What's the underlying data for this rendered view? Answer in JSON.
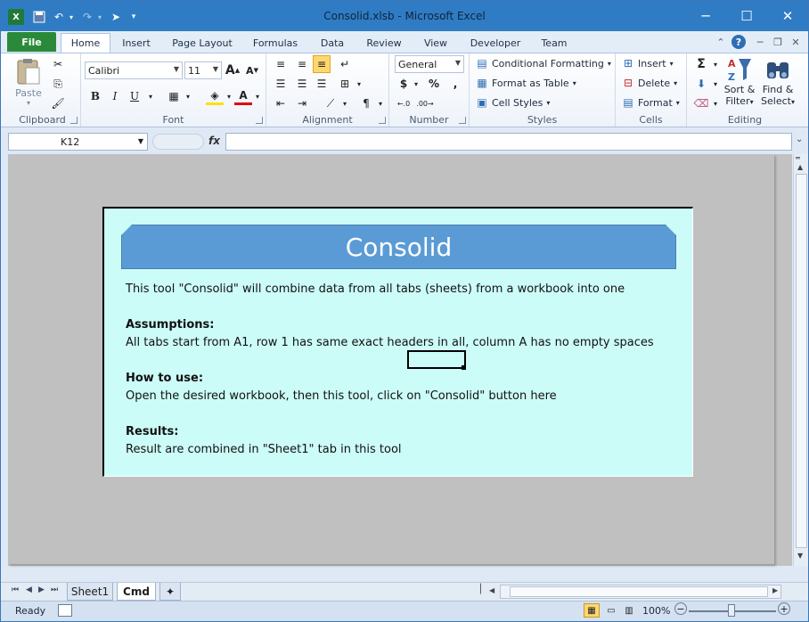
{
  "window": {
    "title": "Consolid.xlsb  -  Microsoft Excel"
  },
  "qat": {
    "excel_icon": "excel-icon",
    "save_icon": "save-icon",
    "undo_icon": "undo-icon",
    "redo_icon": "redo-icon"
  },
  "tabs": {
    "file": "File",
    "items": [
      "Home",
      "Insert",
      "Page Layout",
      "Formulas",
      "Data",
      "Review",
      "View",
      "Developer",
      "Team"
    ]
  },
  "ribbon": {
    "clipboard": {
      "label": "Clipboard",
      "paste": "Paste"
    },
    "font": {
      "label": "Font",
      "name": "Calibri",
      "size": "11"
    },
    "alignment": {
      "label": "Alignment"
    },
    "number": {
      "label": "Number",
      "format": "General",
      "currency": "$",
      "percent": "%",
      "comma": ","
    },
    "styles": {
      "label": "Styles",
      "conditional": "Conditional Formatting",
      "format_table": "Format as Table",
      "cell_styles": "Cell Styles"
    },
    "cells": {
      "label": "Cells",
      "insert": "Insert",
      "delete": "Delete",
      "format": "Format"
    },
    "editing": {
      "label": "Editing",
      "sort_1": "Sort &",
      "sort_2": "Filter",
      "find_1": "Find &",
      "find_2": "Select"
    }
  },
  "formula_bar": {
    "name_box": "K12",
    "fx": "fx",
    "formula": ""
  },
  "document": {
    "banner": "Consolid",
    "intro": "This tool \"Consolid\" will combine data from all tabs (sheets) from a workbook into one",
    "assumptions_heading": "Assumptions:",
    "assumptions_text": "All tabs start from A1, row 1 has same exact headers in all, column A has no empty spaces",
    "howto_heading": "How to use:",
    "howto_text": "Open the desired workbook, then this tool, click on \"Consolid\" button here",
    "results_heading": "Results:",
    "results_text": "Result are combined in \"Sheet1\" tab in this tool"
  },
  "sheets": {
    "items": [
      "Sheet1",
      "Cmd"
    ],
    "active": "Cmd"
  },
  "status": {
    "ready": "Ready",
    "zoom": "100%"
  },
  "colors": {
    "title_bar": "#2f7cc4",
    "file_tab": "#2b8a3a",
    "banner": "#5b9bd5",
    "card_bg": "#ccfcf8"
  }
}
